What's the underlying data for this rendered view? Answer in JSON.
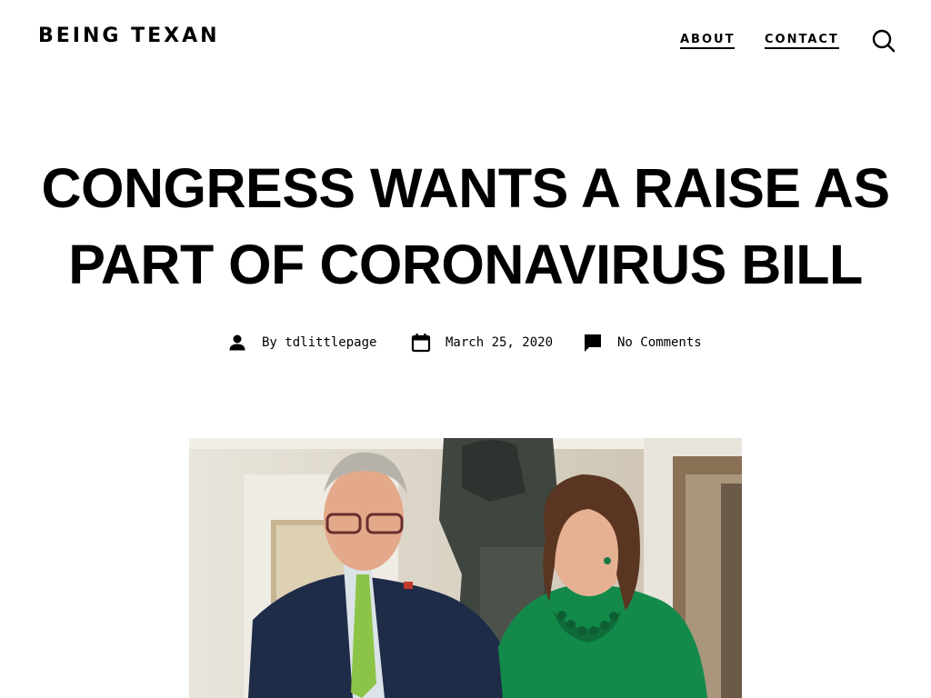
{
  "header": {
    "site_title": "BEING TEXAN",
    "nav": [
      {
        "label": "ABOUT"
      },
      {
        "label": "CONTACT"
      }
    ],
    "search_icon": "search-icon"
  },
  "post": {
    "title_lines": [
      "CONGRESS WANTS A RAISE AS",
      "PART OF CORONAVIRUS BILL"
    ],
    "meta": {
      "author_prefix": "By",
      "author": "tdlittlepage",
      "date": "March 25, 2020",
      "comments": "No Comments"
    },
    "featured_image_alt": "Featured image"
  },
  "colors": {
    "text": "#000000",
    "background": "#ffffff",
    "accent_green": "#138a4a"
  }
}
